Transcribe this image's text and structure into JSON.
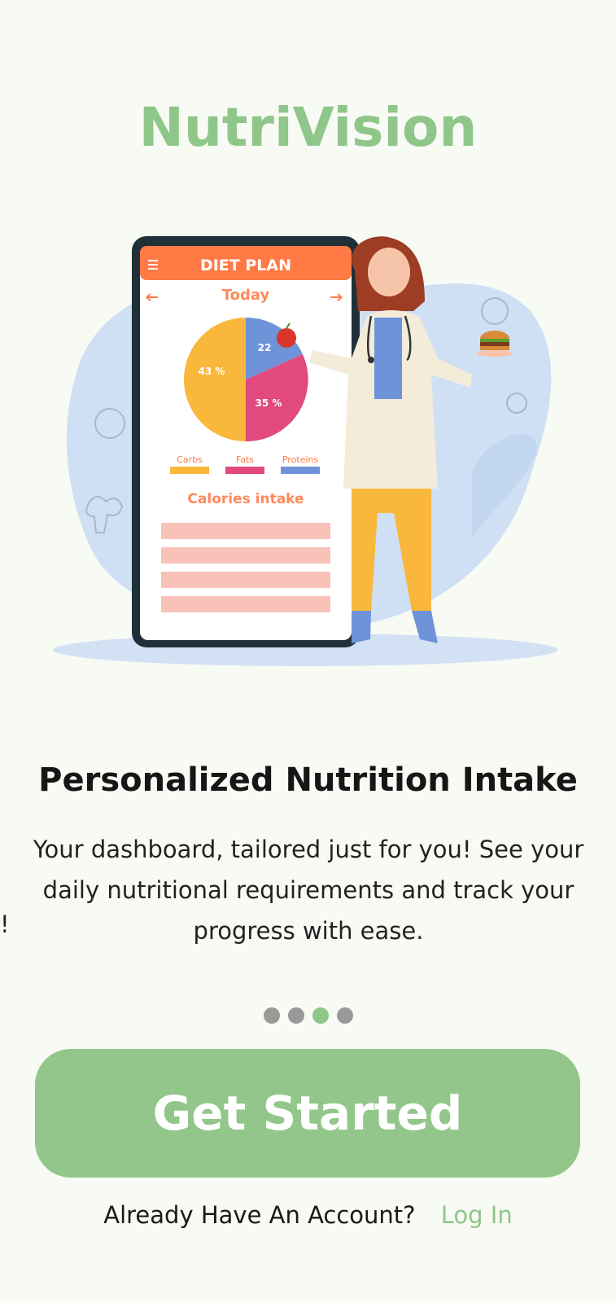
{
  "app": {
    "title": "NutriVision"
  },
  "illustration": {
    "phone_header": "DIET PLAN",
    "day_label": "Today",
    "pie_labels": {
      "carbs": "43 %",
      "fats": "35 %",
      "proteins": "22"
    },
    "legend": [
      "Carbs",
      "Fats",
      "Proteins"
    ],
    "calories_label": "Calories intake",
    "colors": {
      "carbs": "#f9b73b",
      "fats": "#e2497d",
      "proteins": "#6f93d9",
      "header": "#ff7a45"
    }
  },
  "slide": {
    "title": "Personalized Nutrition Intake",
    "description": "Your dashboard, tailored just for you! See your daily nutritional requirements and track your progress with ease.",
    "edge_text": "!"
  },
  "pager": {
    "count": 4,
    "active_index": 2
  },
  "cta": {
    "label": "Get Started"
  },
  "account": {
    "prompt": "Already Have An Account?",
    "login": "Log In"
  },
  "theme": {
    "accent": "#8fc689",
    "background": "#f8faf4"
  }
}
